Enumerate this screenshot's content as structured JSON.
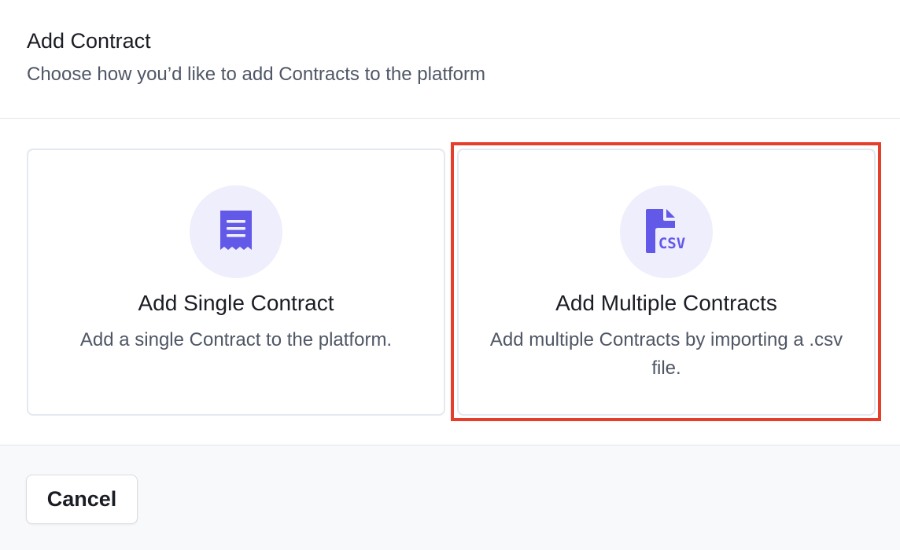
{
  "dialog": {
    "title": "Add Contract",
    "subtitle": "Choose how you’d like to add Contracts to the platform"
  },
  "options": [
    {
      "icon": "receipt-icon",
      "title": "Add Single Contract",
      "description": "Add a single Contract to the platform."
    },
    {
      "icon": "csv-file-icon",
      "icon_text": "CSV",
      "title": "Add Multiple Contracts",
      "description": "Add multiple Contracts by importing a .csv file.",
      "highlighted": true
    }
  ],
  "footer": {
    "cancel_label": "Cancel"
  },
  "colors": {
    "accent": "#6359e9",
    "icon_background": "#eeeefc",
    "highlight": "#e53e2b"
  }
}
